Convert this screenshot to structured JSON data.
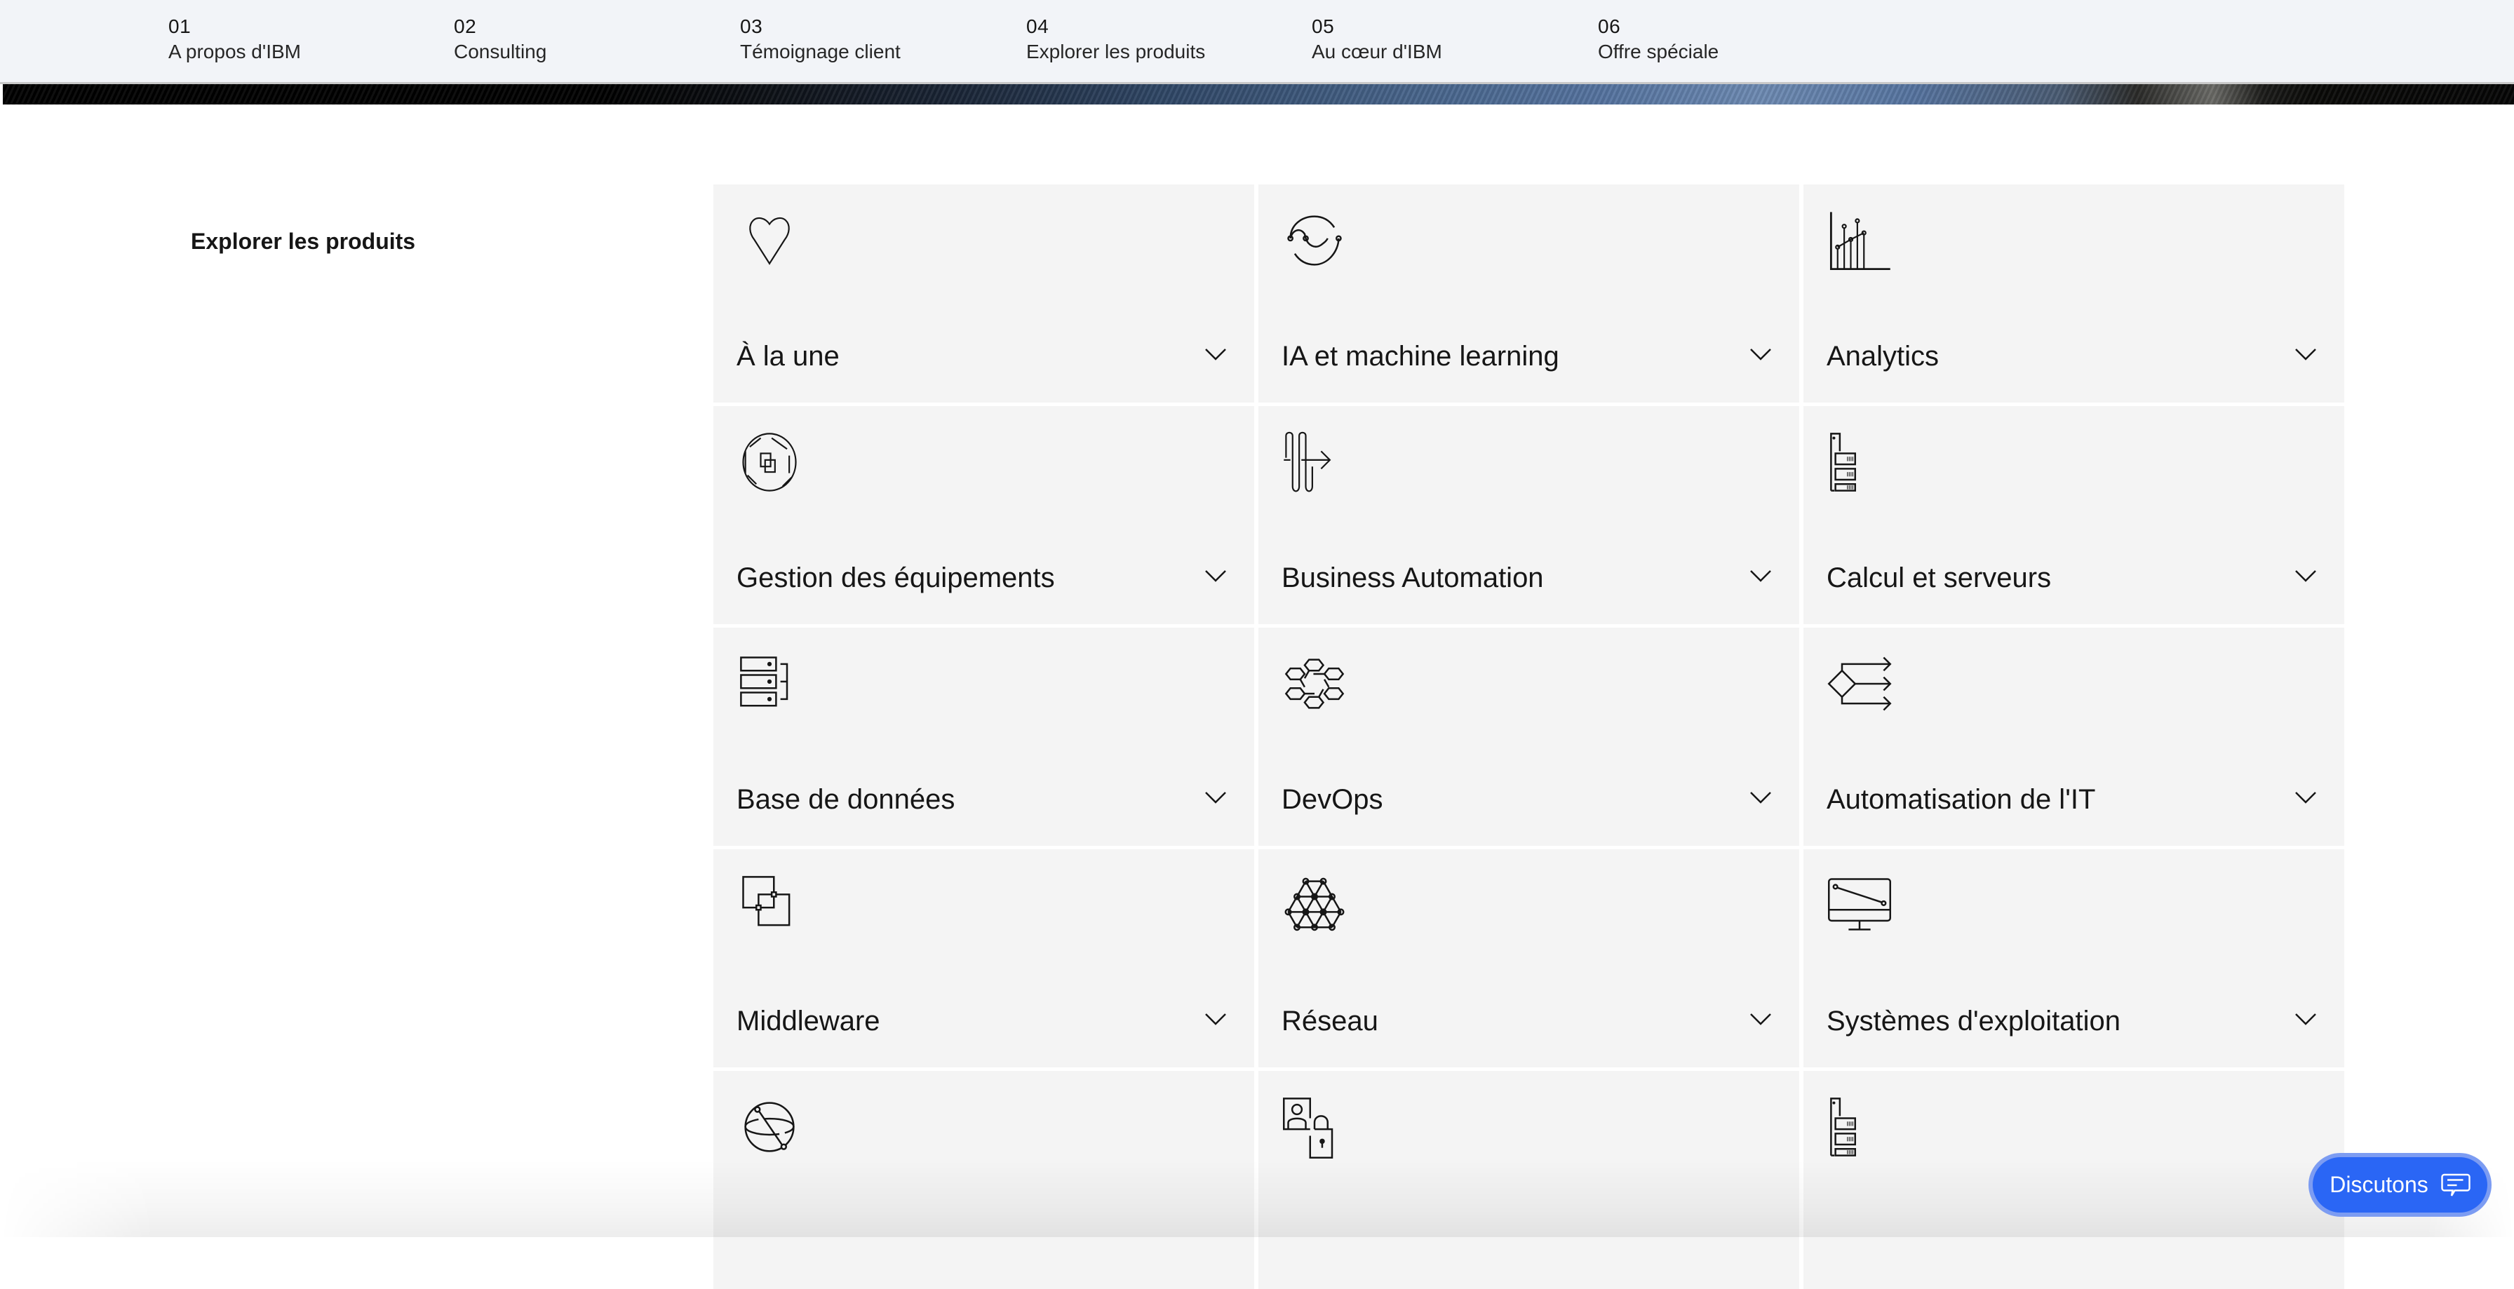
{
  "topnav": {
    "items": [
      {
        "number": "01",
        "label": "A propos d'IBM"
      },
      {
        "number": "02",
        "label": "Consulting"
      },
      {
        "number": "03",
        "label": "Témoignage client"
      },
      {
        "number": "04",
        "label": "Explorer les produits"
      },
      {
        "number": "05",
        "label": "Au cœur d'IBM"
      },
      {
        "number": "06",
        "label": "Offre spéciale"
      }
    ]
  },
  "section": {
    "title": "Explorer les produits"
  },
  "products": [
    {
      "label": "À la une",
      "icon": "heart-icon"
    },
    {
      "label": "IA et machine learning",
      "icon": "ai-cycle-icon"
    },
    {
      "label": "Analytics",
      "icon": "analytics-chart-icon"
    },
    {
      "label": "Gestion des équipements",
      "icon": "asset-management-icon"
    },
    {
      "label": "Business Automation",
      "icon": "business-automation-icon"
    },
    {
      "label": "Calcul et serveurs",
      "icon": "server-rack-icon"
    },
    {
      "label": "Base de données",
      "icon": "database-icon"
    },
    {
      "label": "DevOps",
      "icon": "devops-hexagons-icon"
    },
    {
      "label": "Automatisation de l'IT",
      "icon": "decision-flow-icon"
    },
    {
      "label": "Middleware",
      "icon": "middleware-squares-icon"
    },
    {
      "label": "Réseau",
      "icon": "network-hexagons-icon"
    },
    {
      "label": "Systèmes d'exploitation",
      "icon": "monitor-icon"
    },
    {
      "label": "",
      "icon": "globe-orbit-icon"
    },
    {
      "label": "",
      "icon": "user-lock-icon"
    },
    {
      "label": "",
      "icon": "server-rack-icon"
    }
  ],
  "chat": {
    "label": "Discutons",
    "icon": "chat-bubble-icon",
    "color": "#2a66f5"
  }
}
